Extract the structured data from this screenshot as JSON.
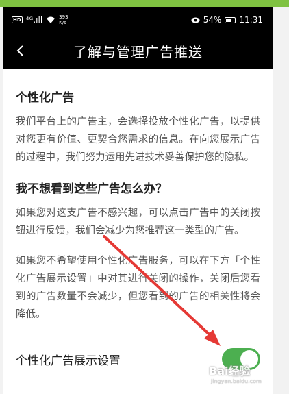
{
  "status_bar": {
    "hd": "HD",
    "signal": "⁴ᴳ.ıll",
    "speed_value": "393",
    "speed_unit": "K/s",
    "battery": "54%",
    "time": "11:31"
  },
  "header": {
    "title": "了解与管理广告推送"
  },
  "sections": [
    {
      "title": "个性化广告",
      "paragraphs": [
        "我们平台上的广告主，会选择投放个性化广告，以提供对您更有价值、更契合您需求的信息。在向您展示广告的过程中，我们努力运用先进技术妥善保护您的隐私。"
      ]
    },
    {
      "title": "我不想看到这些广告怎么办？",
      "paragraphs": [
        "如果您对这支广告不感兴趣，可以点击广告中的关闭按钮进行反馈，我们会减少为您推荐这一类型的广告。",
        "如果您不希望使用个性化广告服务，可以在下方「个性化广告展示设置」中对其进行关闭的操作，关闭后您看到的广告数量不会减少，但您看到的广告的相关性将会降低。"
      ]
    }
  ],
  "settings": {
    "label": "个性化广告展示设置",
    "toggle_on": true,
    "toggle_color": "#4caf50"
  },
  "watermark": {
    "text": "Bai经验",
    "sub": "jingyan.baidu.com"
  }
}
